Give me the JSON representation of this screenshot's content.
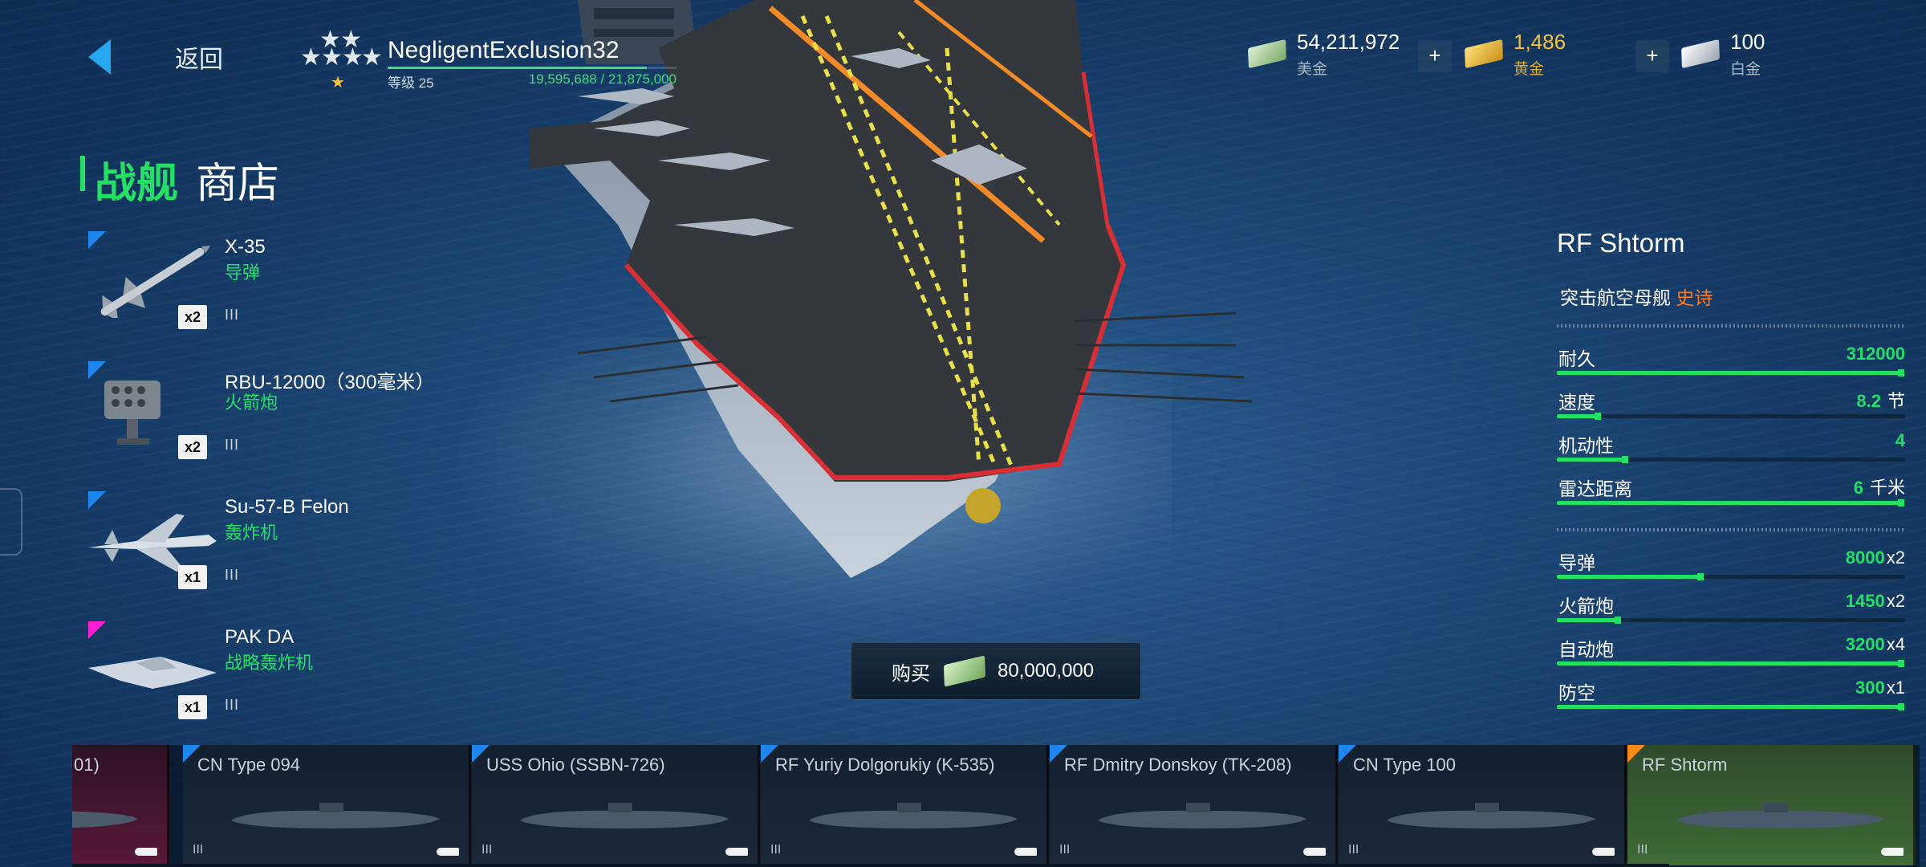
{
  "header": {
    "back_label": "返回",
    "player_name": "NegligentExclusion32",
    "level_label": "等级 25",
    "xp_text": "19,595,688 / 21,875,000",
    "xp_progress": 0.896
  },
  "currencies": [
    {
      "value": "54,211,972",
      "label": "美金",
      "icon": "cash-icon",
      "color": "#ffffff"
    },
    {
      "value": "1,486",
      "label": "黄金",
      "icon": "gold-bar-icon",
      "color": "#f2c23a"
    },
    {
      "value": "100",
      "label": "白金",
      "icon": "platinum-bar-icon",
      "color": "#ffffff"
    }
  ],
  "plus_label": "+",
  "page_title": {
    "main": "战舰",
    "sub": "商店"
  },
  "weapons": [
    {
      "name": "X-35",
      "type": "导弹",
      "count": "x2",
      "tier": "III",
      "corner": "blue"
    },
    {
      "name": "RBU-12000（300毫米）",
      "type": "火箭炮",
      "count": "x2",
      "tier": "III",
      "corner": "blue"
    },
    {
      "name": "Su-57-B Felon",
      "type": "轰炸机",
      "count": "x1",
      "tier": "III",
      "corner": "blue"
    },
    {
      "name": "PAK DA",
      "type": "战略轰炸机",
      "count": "x1",
      "tier": "III",
      "corner": "pink"
    }
  ],
  "ship": {
    "name": "RF Shtorm",
    "class": "突击航空母舰",
    "rarity": "史诗",
    "stats": [
      {
        "label": "耐久",
        "value": "312000",
        "unit": "",
        "level": 1.0
      },
      {
        "label": "速度",
        "value": "8.2",
        "unit": "节",
        "level": 0.12
      },
      {
        "label": "机动性",
        "value": "4",
        "unit": "",
        "level": 0.2
      },
      {
        "label": "雷达距离",
        "value": "6",
        "unit": "千米",
        "level": 1.0
      }
    ],
    "weapon_stats": [
      {
        "label": "导弹",
        "value": "8000",
        "mult": "x2",
        "level": 0.42
      },
      {
        "label": "火箭炮",
        "value": "1450",
        "mult": "x2",
        "level": 0.18
      },
      {
        "label": "自动炮",
        "value": "3200",
        "mult": "x4",
        "level": 1.0
      },
      {
        "label": "防空",
        "value": "300",
        "mult": "x1",
        "level": 1.0
      }
    ]
  },
  "buy": {
    "label": "购买",
    "price": "80,000,000"
  },
  "carousel": [
    {
      "name": "01)",
      "tier": "",
      "selected": false,
      "partial": true
    },
    {
      "name": "CN Type 094",
      "tier": "III",
      "selected": false,
      "partial": false
    },
    {
      "name": "USS Ohio (SSBN-726)",
      "tier": "III",
      "selected": false,
      "partial": false
    },
    {
      "name": "RF Yuriy Dolgorukiy (K-535)",
      "tier": "III",
      "selected": false,
      "partial": false
    },
    {
      "name": "RF Dmitry Donskoy (TK-208)",
      "tier": "III",
      "selected": false,
      "partial": false
    },
    {
      "name": "CN Type 100",
      "tier": "III",
      "selected": false,
      "partial": false
    },
    {
      "name": "RF Shtorm",
      "tier": "III",
      "selected": true,
      "partial": false
    }
  ]
}
